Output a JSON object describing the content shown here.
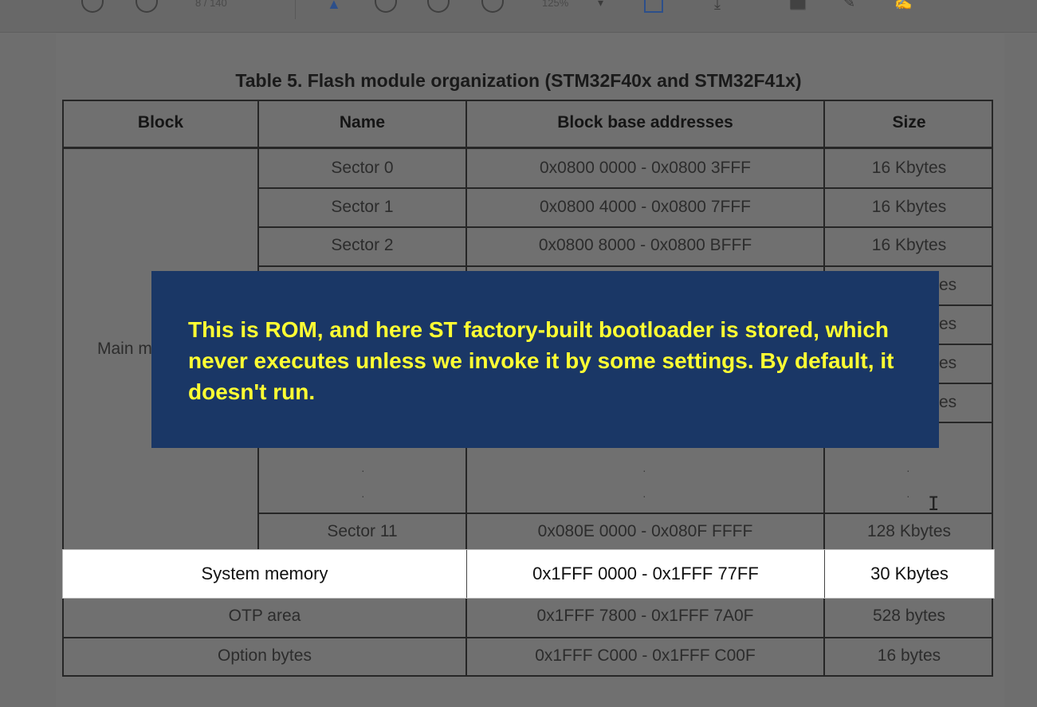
{
  "toolbar": {
    "page_indicator": "8 / 140",
    "zoom": "125%"
  },
  "table": {
    "title": "Table 5. Flash module organization (STM32F40x and STM32F41x)",
    "headers": [
      "Block",
      "Name",
      "Block base addresses",
      "Size"
    ],
    "main_block_label": "Main memory",
    "sectors": [
      {
        "name": "Sector 0",
        "address": "0x0800 0000 - 0x0800 3FFF",
        "size": "16 Kbytes"
      },
      {
        "name": "Sector 1",
        "address": "0x0800 4000 - 0x0800 7FFF",
        "size": "16 Kbytes"
      },
      {
        "name": "Sector 2",
        "address": "0x0800 8000 - 0x0800 BFFF",
        "size": "16 Kbytes"
      },
      {
        "name": "Sector 11",
        "address": "0x080E 0000 - 0x080F FFFF",
        "size": "128 Kbytes"
      }
    ],
    "partial_sizes": [
      "es",
      "es",
      "es",
      "es"
    ],
    "system_memory": {
      "name": "System memory",
      "address": "0x1FFF 0000 - 0x1FFF 77FF",
      "size": "30 Kbytes"
    },
    "otp": {
      "name": "OTP area",
      "address": "0x1FFF 7800 - 0x1FFF 7A0F",
      "size": "528 bytes"
    },
    "option_bytes": {
      "name": "Option bytes",
      "address": "0x1FFF C000 - 0x1FFF C00F",
      "size": "16 bytes"
    }
  },
  "callout": {
    "text": "This is ROM, and here ST factory-built bootloader is stored, which never executes unless we invoke it by some settings. By default, it doesn't run."
  }
}
